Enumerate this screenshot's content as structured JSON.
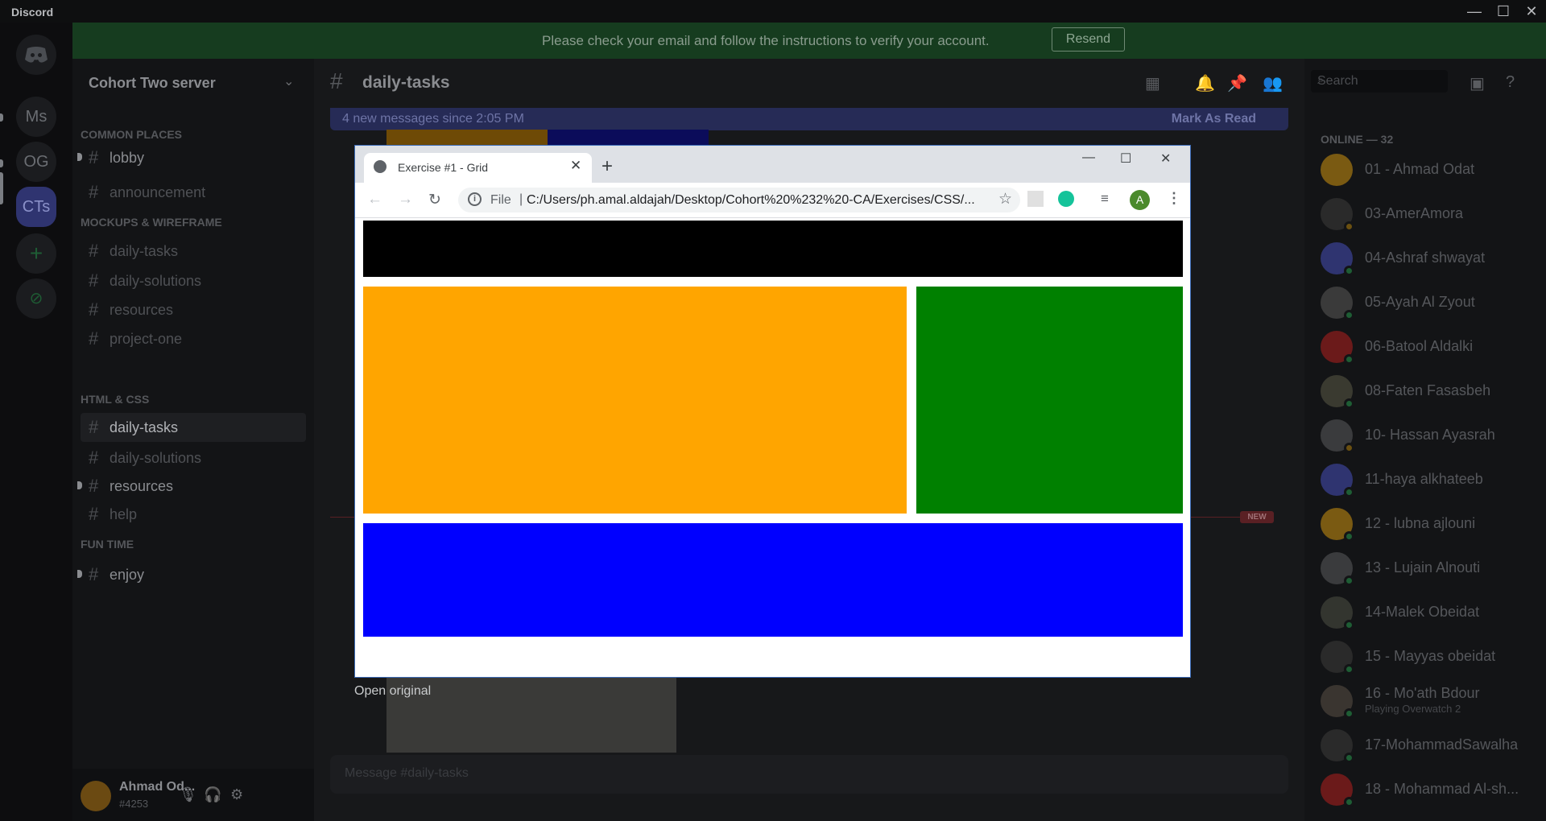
{
  "app": {
    "title": "Discord",
    "minimize": "—",
    "maximize": "☐",
    "close": "✕"
  },
  "rail": {
    "servers": [
      "Ms",
      "OG",
      "CTs"
    ],
    "add_label": "+",
    "explore_label": "⊘"
  },
  "banner": {
    "text": "Please check your email and follow the instructions to verify your account.",
    "button": "Resend"
  },
  "sidebar": {
    "server_name": "Cohort Two server",
    "chevron": "⌄",
    "categories": {
      "common": "COMMON PLACES",
      "mockups": "MOCKUPS & WIREFRAME",
      "html": "HTML & CSS",
      "fun": "FUN TIME"
    },
    "channels": {
      "lobby": "lobby",
      "announcement": "announcement",
      "mw_daily_tasks": "daily-tasks",
      "mw_daily_solutions": "daily-solutions",
      "mw_resources": "resources",
      "mw_project_one": "project-one",
      "html_daily_tasks": "daily-tasks",
      "html_daily_solutions": "daily-solutions",
      "html_resources": "resources",
      "html_help": "help",
      "enjoy": "enjoy"
    },
    "hash": "#"
  },
  "user": {
    "name": "Ahmad Od...",
    "tag": "#4253",
    "mic": "🎙",
    "headset": "🎧",
    "settings": "⚙"
  },
  "chat": {
    "channel": "daily-tasks",
    "new_messages": "4 new messages since 2:05 PM",
    "mark_read": "Mark As Read",
    "new_tag": "NEW",
    "input_placeholder": "Message #daily-tasks"
  },
  "members": {
    "search_placeholder": "Search",
    "online_header": "ONLINE — 32",
    "list": [
      {
        "name": "01 - Ahmad Odat"
      },
      {
        "name": "03-AmerAmora"
      },
      {
        "name": "04-Ashraf shwayat"
      },
      {
        "name": "05-Ayah Al Zyout"
      },
      {
        "name": "06-Batool Aldalki"
      },
      {
        "name": "08-Faten Fasasbeh"
      },
      {
        "name": "10- Hassan Ayasrah"
      },
      {
        "name": "11-haya alkhateeb"
      },
      {
        "name": "12 - lubna ajlouni"
      },
      {
        "name": "13 - Lujain Alnouti"
      },
      {
        "name": "14-Malek Obeidat"
      },
      {
        "name": "15 - Mayyas obeidat"
      },
      {
        "name": "16 - Mo'ath Bdour",
        "status": "Playing Overwatch 2"
      },
      {
        "name": "17-MohammadSawalha"
      },
      {
        "name": "18 - Mohammad Al-sh..."
      }
    ]
  },
  "browser": {
    "tab_title": "Exercise #1 - Grid",
    "tab_close": "✕",
    "new_tab": "+",
    "scheme": "File",
    "url": "C:/Users/ph.amal.aldajah/Desktop/Cohort%20%232%20-CA/Exercises/CSS/...",
    "profile_initial": "A",
    "nav_back": "←",
    "nav_forward": "→",
    "nav_reload": "↻",
    "star": "☆",
    "menu": "⋮",
    "grid_colors": {
      "header": "#000000",
      "main": "#ffa500",
      "side": "#008000",
      "footer": "#0000ff"
    }
  },
  "lightbox": {
    "open_original": "Open original"
  },
  "colors": {
    "discord_dark": "#0f1012",
    "banner_green": "#163c1f",
    "blurple": "#262b56"
  }
}
